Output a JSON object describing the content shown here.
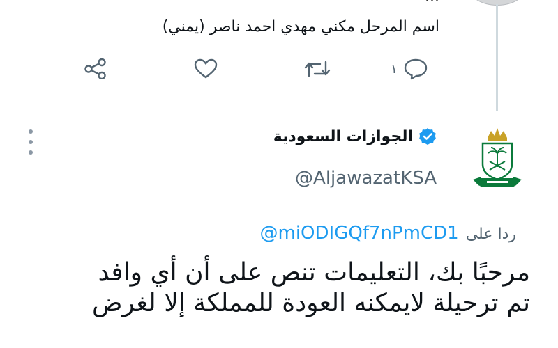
{
  "previous_tweet": {
    "text_line_cut": "...",
    "text_line_2": "اسم المرحل مكني مهدي احمد ناصر (يمني)",
    "actions": {
      "reply_count": "١",
      "reply_icon": "reply-icon",
      "retweet_icon": "retweet-icon",
      "like_icon": "heart-icon",
      "share_icon": "share-icon"
    }
  },
  "tweet": {
    "author_name": "الجوازات السعودية",
    "verified": true,
    "handle": "@AljawazatKSA",
    "logo_icon": "jawazat-logo",
    "replying_label": "ردا على",
    "replying_to": "@miODIGQf7nPmCD1",
    "body_lines": [
      "مرحبًا بك، التعليمات تنص على أن أي وافد",
      "تم ترحيلة لايمكنه العودة للمملكة إلا لغرض"
    ]
  },
  "colors": {
    "accent": "#1d9bf0",
    "text": "#0f1419",
    "muted": "#536471",
    "thread_line": "#cfd9de",
    "logo_green": "#0b7a3b",
    "logo_gold": "#c9a227"
  }
}
